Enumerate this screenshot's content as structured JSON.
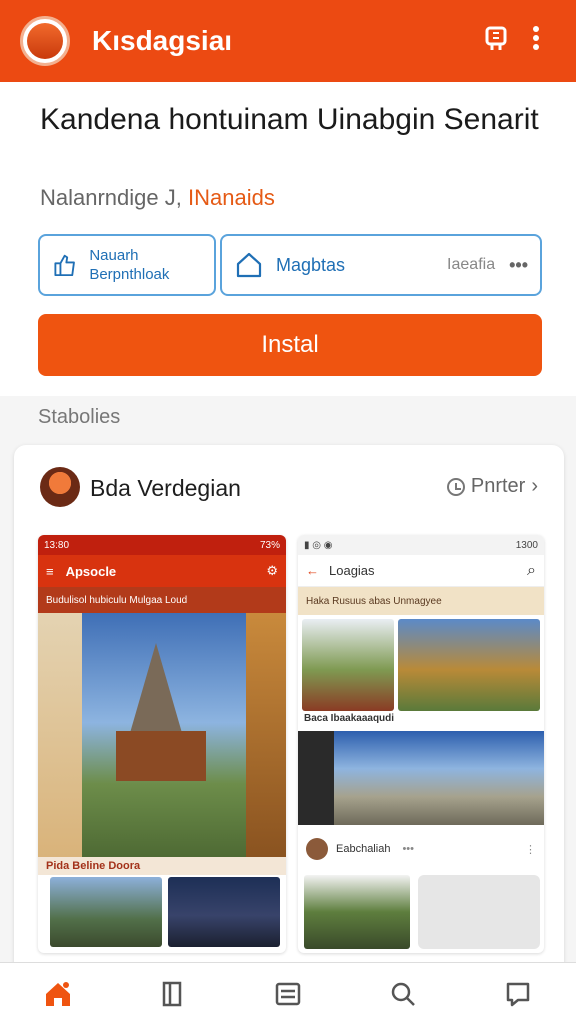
{
  "appbar": {
    "title": "Kısdagsiaı",
    "share_icon": "share-icon",
    "more_icon": "more-vert-icon"
  },
  "app": {
    "name": "Kandena hontuinam Uinabgin Senarit",
    "developer": "Nalanrndige J,",
    "developer_link": "INanaids"
  },
  "meta": {
    "box1_label": "Nauarh Berpnthloak",
    "box2_label": "Magbtas",
    "box2_extra": "Iaeafia",
    "box2_more": "•••"
  },
  "install": {
    "label": "Instal"
  },
  "section": {
    "title": "Stabolies"
  },
  "card": {
    "title": "Bda Verdegian",
    "preview_label": "Pnrter",
    "shot_a": {
      "status_left": "13:80",
      "status_right": "73%",
      "bar_title": "Apsocle",
      "banner": "Budulisol hubiculu Mulgaa Loud",
      "caption": "Pida Beline Doora"
    },
    "shot_b": {
      "status_right": "1300",
      "bar_title": "Loagias",
      "banner": "Haka Rusuus abas Unmagyee",
      "caption": "Baca Ibaakaaaqudi",
      "post_name": "Eabchaliah",
      "post_dots": "•••"
    }
  },
  "colors": {
    "primary": "#ec4a12",
    "install": "#ef5410",
    "link": "#1f6fb5"
  }
}
